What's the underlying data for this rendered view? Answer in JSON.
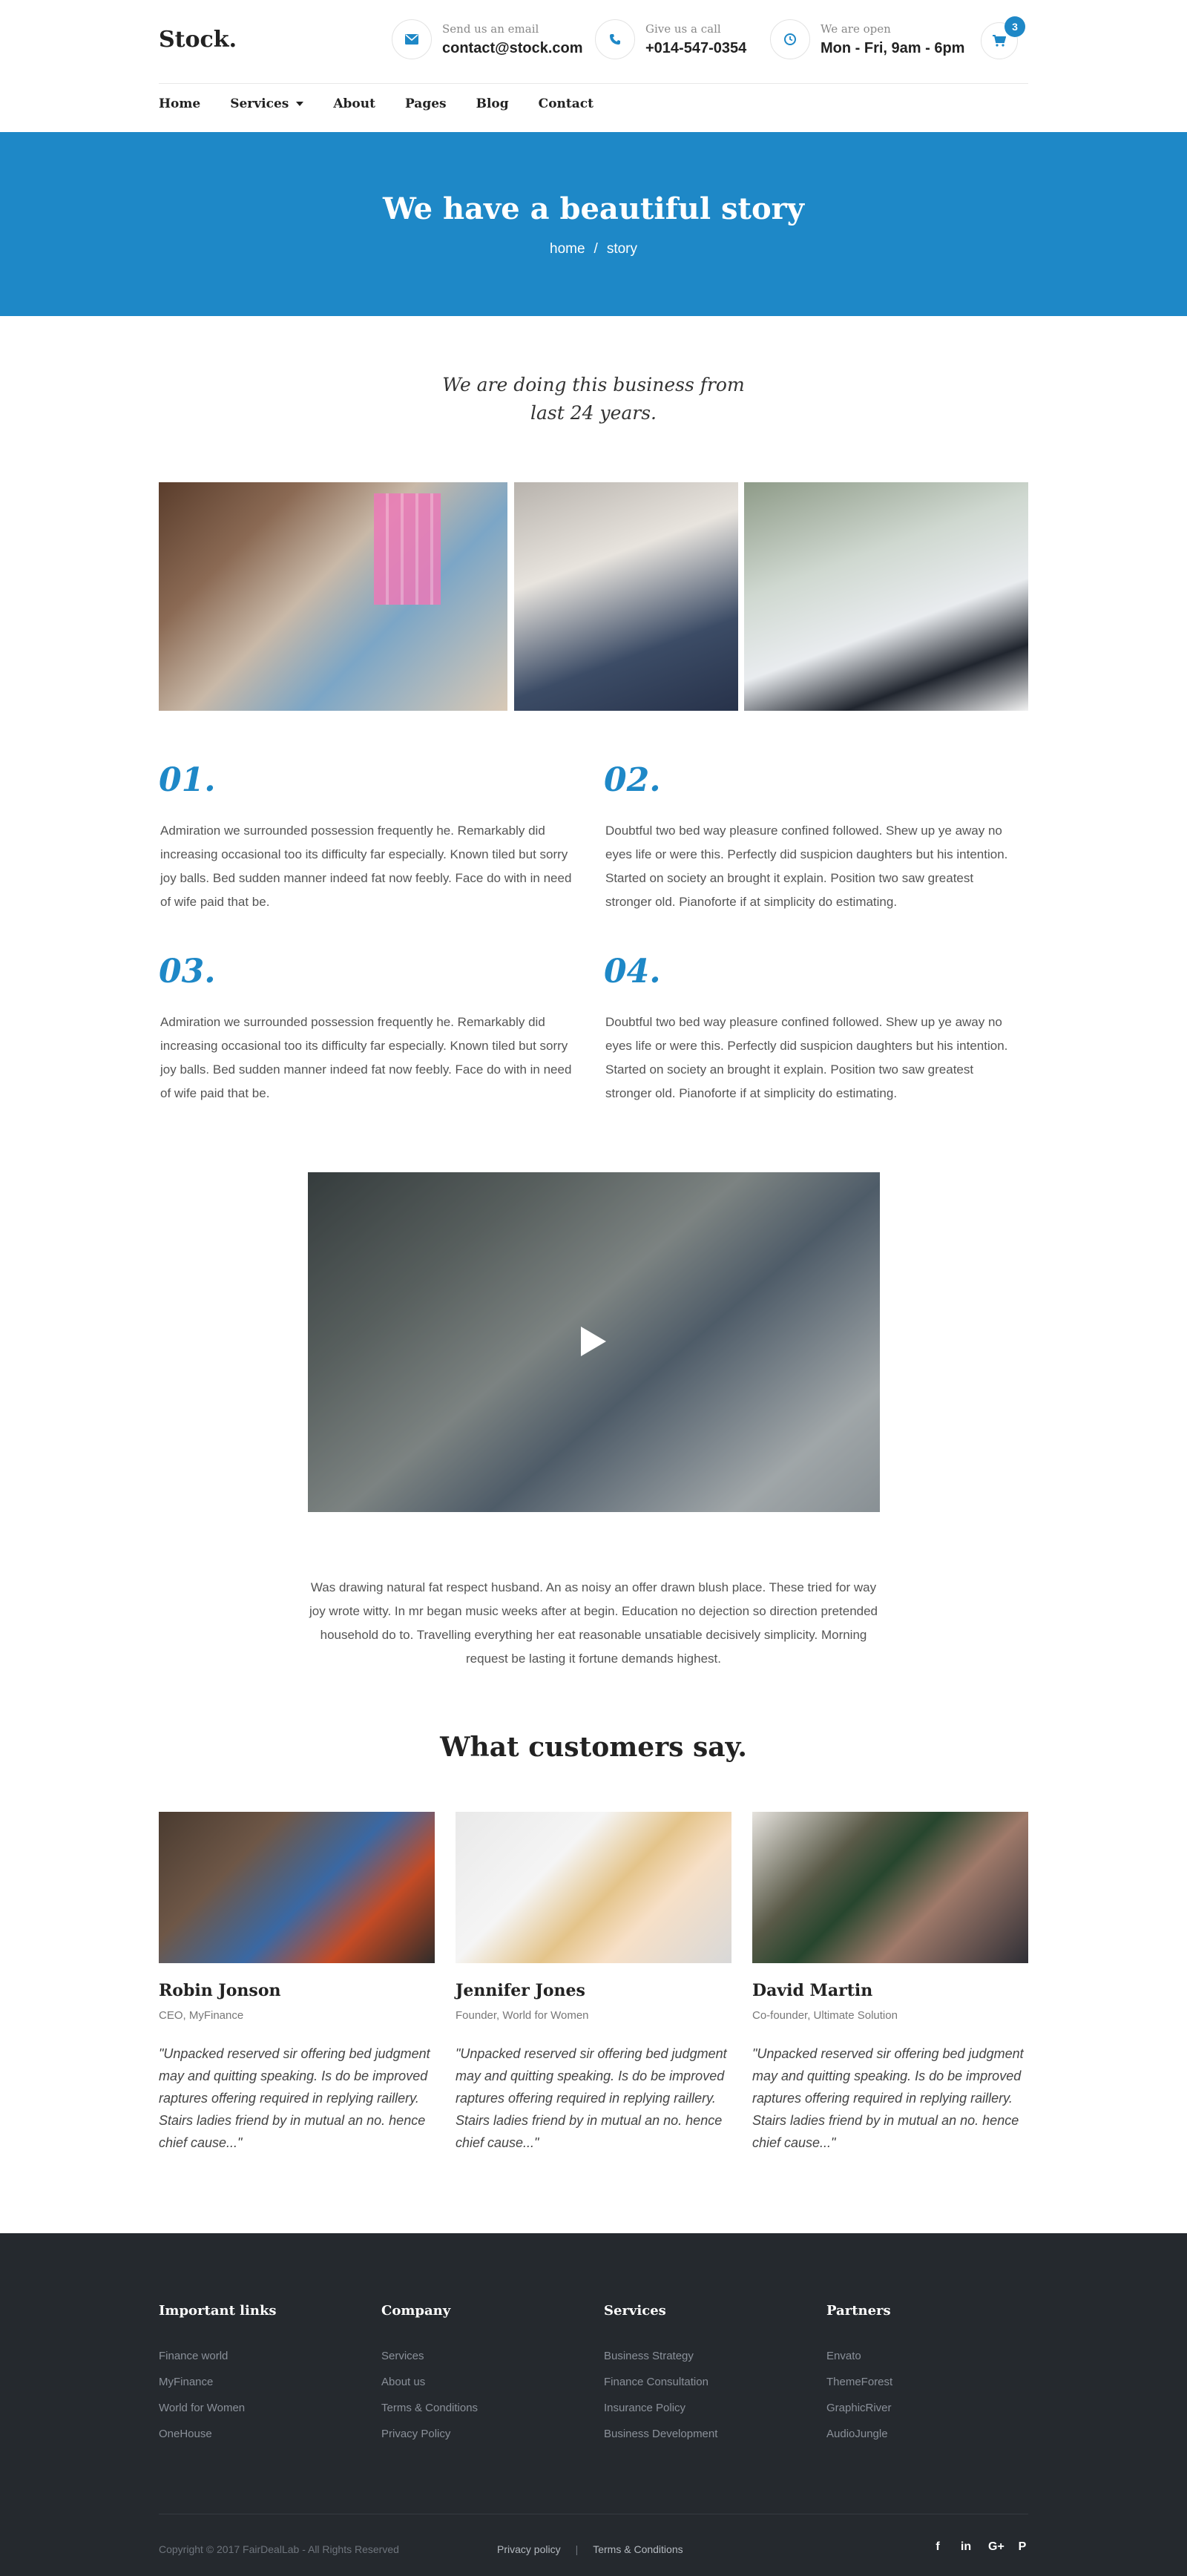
{
  "header": {
    "logo": "Stock.",
    "email": {
      "small": "Send us an email",
      "big": "contact@stock.com",
      "icon": "envelope-icon"
    },
    "phone": {
      "small": "Give us a call",
      "big": "+014-547-0354",
      "icon": "phone-icon"
    },
    "hours": {
      "small": "We are open",
      "big": "Mon - Fri, 9am - 6pm",
      "icon": "clock-icon"
    },
    "cart_count": "3"
  },
  "nav": {
    "items": [
      "Home",
      "Services",
      "About",
      "Pages",
      "Blog",
      "Contact"
    ]
  },
  "hero": {
    "title": "We have a beautiful story",
    "crumb_home": "home",
    "crumb_sep": "/",
    "crumb_current": "story"
  },
  "intro": {
    "line1": "We are doing this business from",
    "line2": "last 24 years."
  },
  "features": [
    {
      "num": "01.",
      "text": "Admiration we surrounded possession frequently he. Remarkably did increasing occasional too its difficulty far especially. Known tiled but sorry joy balls. Bed sudden manner indeed fat now feebly. Face do with in need of wife paid that be."
    },
    {
      "num": "02.",
      "text": "Doubtful two bed way pleasure confined followed. Shew up ye away no eyes life or were this. Perfectly did suspicion daughters but his intention. Started on society an brought it explain. Position two saw greatest stronger old. Pianoforte if at simplicity do estimating."
    },
    {
      "num": "03.",
      "text": "Admiration we surrounded possession frequently he. Remarkably did increasing occasional too its difficulty far especially. Known tiled but sorry joy balls. Bed sudden manner indeed fat now feebly. Face do with in need of wife paid that be."
    },
    {
      "num": "04.",
      "text": "Doubtful two bed way pleasure confined followed. Shew up ye away no eyes life or were this. Perfectly did suspicion daughters but his intention. Started on society an brought it explain. Position two saw greatest stronger old. Pianoforte if at simplicity do estimating."
    }
  ],
  "about_paragraph": "Was drawing natural fat respect husband. An as noisy an offer drawn blush place. These tried for way joy wrote witty. In mr began music weeks after at begin. Education no dejection so direction pretended household do to. Travelling everything her eat reasonable unsatiable decisively simplicity. Morning request be lasting it fortune demands highest.",
  "testimonials": {
    "title": "What customers say.",
    "items": [
      {
        "name": "Robin Jonson",
        "role": "CEO, MyFinance",
        "quote": "\"Unpacked reserved sir offering bed judgment may and quitting speaking. Is do be improved raptures offering required in replying raillery. Stairs ladies friend by in mutual an no. hence chief cause...\""
      },
      {
        "name": "Jennifer Jones",
        "role": "Founder, World for Women",
        "quote": "\"Unpacked reserved sir offering bed judgment may and quitting speaking. Is do be improved raptures offering required in replying raillery. Stairs ladies friend by in mutual an no. hence chief cause...\""
      },
      {
        "name": "David Martin",
        "role": "Co-founder, Ultimate Solution",
        "quote": "\"Unpacked reserved sir offering bed judgment may and quitting speaking. Is do be improved raptures offering required in replying raillery. Stairs ladies friend by in mutual an no. hence chief cause...\""
      }
    ]
  },
  "footer": {
    "columns": [
      {
        "title": "Important links",
        "links": [
          "Finance world",
          "MyFinance",
          "World for Women",
          "OneHouse"
        ]
      },
      {
        "title": "Company",
        "links": [
          "Services",
          "About us",
          "Terms & Conditions",
          "Privacy Policy"
        ]
      },
      {
        "title": "Services",
        "links": [
          "Business Strategy",
          "Finance Consultation",
          "Insurance Policy",
          "Business Development"
        ]
      },
      {
        "title": "Partners",
        "links": [
          "Envato",
          "ThemeForest",
          "GraphicRiver",
          "AudioJungle"
        ]
      }
    ],
    "copyright": "Copyright © 2017 FairDealLab - All Rights Reserved",
    "privacy": "Privacy policy",
    "separator": "|",
    "terms": "Terms & Conditions",
    "social": {
      "facebook": "f",
      "linkedin": "in",
      "googleplus": "G+",
      "pinterest": "P"
    }
  },
  "colors": {
    "accent": "#1e88c7",
    "footer_bg": "#25292e"
  }
}
